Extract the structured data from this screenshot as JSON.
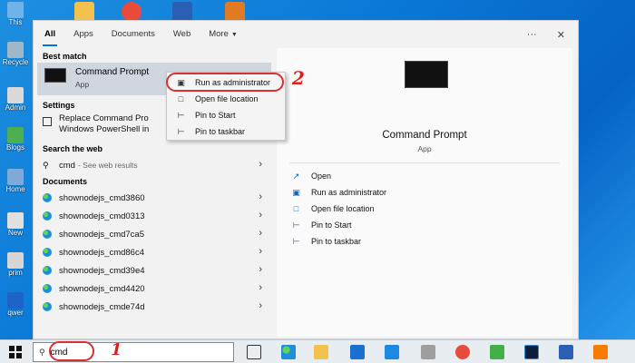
{
  "desktop": {
    "labels": [
      "This",
      "Recycle",
      "Admin",
      "Blogs",
      "Home",
      "New",
      "prim",
      "qwer"
    ]
  },
  "tabs": [
    {
      "label": "All"
    },
    {
      "label": "Apps"
    },
    {
      "label": "Documents"
    },
    {
      "label": "Web"
    },
    {
      "label": "More"
    }
  ],
  "top_right": {
    "more_label": "···",
    "close_label": "✕"
  },
  "best_match": {
    "heading": "Best match",
    "title": "Command Prompt",
    "subtitle": "App"
  },
  "settings": {
    "heading": "Settings",
    "line1": "Replace Command Pro",
    "line2": "Windows PowerShell in"
  },
  "web": {
    "heading": "Search the web",
    "query": "cmd",
    "suffix": "- See web results"
  },
  "documents": {
    "heading": "Documents",
    "items": [
      "shownodejs_cmd3860",
      "shownodejs_cmd0313",
      "shownodejs_cmd7ca5",
      "shownodejs_cmd86c4",
      "shownodejs_cmd39e4",
      "shownodejs_cmd4420",
      "shownodejs_cmde74d"
    ]
  },
  "context_menu": {
    "items": [
      "Run as administrator",
      "Open file location",
      "Pin to Start",
      "Pin to taskbar"
    ]
  },
  "detail": {
    "title": "Command Prompt",
    "subtitle": "App",
    "actions": [
      "Open",
      "Run as administrator",
      "Open file location",
      "Pin to Start",
      "Pin to taskbar"
    ]
  },
  "annotations": {
    "step1": "1",
    "step2": "2"
  },
  "taskbar": {
    "search_value": "cmd"
  },
  "colors": {
    "accent": "#0078d4",
    "annotation": "#d83030",
    "desktop": "#0a78d7"
  }
}
